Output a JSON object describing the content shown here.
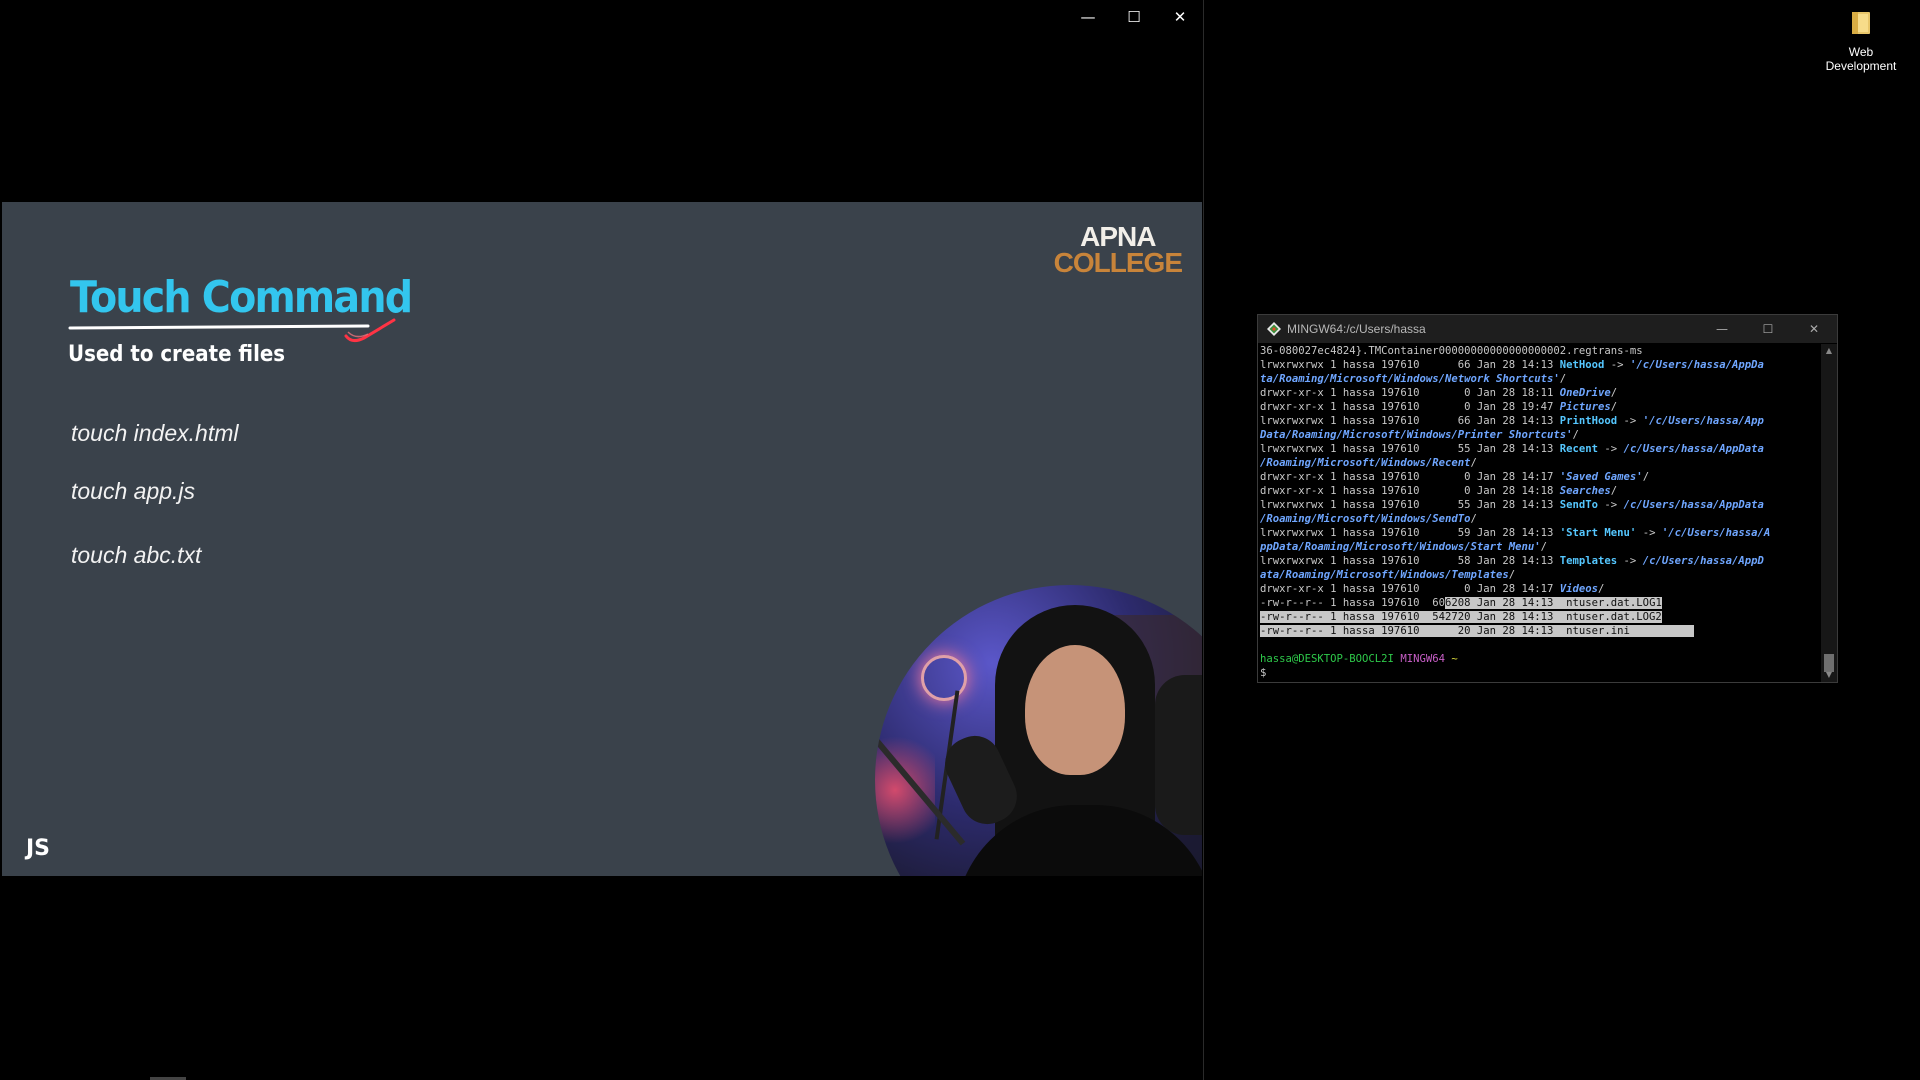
{
  "player": {
    "window_controls": {
      "minimize": "—",
      "maximize": "☐",
      "close": "✕"
    },
    "slide": {
      "brand_line1": "APNA",
      "brand_line2": "COLLEGE",
      "title": "Touch Command",
      "subtitle": "Used to create files",
      "commands": [
        "touch index.html",
        "touch app.js",
        "touch abc.txt"
      ],
      "badge": "JS"
    }
  },
  "terminal": {
    "title": "MINGW64:/c/Users/hassa",
    "controls": {
      "minimize": "—",
      "maximize": "☐",
      "close": "✕"
    },
    "lines": [
      {
        "segments": [
          {
            "t": "36-080027ec4824}.TMContainer00000000000000000002.regtrans-ms",
            "c": ""
          }
        ]
      },
      {
        "segments": [
          {
            "t": "lrwxrwxrwx 1 hassa 197610      66 Jan 28 14:13 ",
            "c": ""
          },
          {
            "t": "NetHood",
            "c": "lnk"
          },
          {
            "t": " -> ",
            "c": ""
          },
          {
            "t": "'/c/Users/hassa/AppDa",
            "c": "path"
          }
        ]
      },
      {
        "segments": [
          {
            "t": "ta/Roaming/Microsoft/Windows/Network Shortcuts'",
            "c": "path"
          },
          {
            "t": "/",
            "c": ""
          }
        ]
      },
      {
        "segments": [
          {
            "t": "drwxr-xr-x 1 hassa 197610       0 Jan 28 18:11 ",
            "c": ""
          },
          {
            "t": "OneDrive",
            "c": "dir"
          },
          {
            "t": "/",
            "c": ""
          }
        ]
      },
      {
        "segments": [
          {
            "t": "drwxr-xr-x 1 hassa 197610       0 Jan 28 19:47 ",
            "c": ""
          },
          {
            "t": "Pictures",
            "c": "dir"
          },
          {
            "t": "/",
            "c": ""
          }
        ]
      },
      {
        "segments": [
          {
            "t": "lrwxrwxrwx 1 hassa 197610      66 Jan 28 14:13 ",
            "c": ""
          },
          {
            "t": "PrintHood",
            "c": "lnk"
          },
          {
            "t": " -> ",
            "c": ""
          },
          {
            "t": "'/c/Users/hassa/App",
            "c": "path"
          }
        ]
      },
      {
        "segments": [
          {
            "t": "Data/Roaming/Microsoft/Windows/Printer Shortcuts'",
            "c": "path"
          },
          {
            "t": "/",
            "c": ""
          }
        ]
      },
      {
        "segments": [
          {
            "t": "lrwxrwxrwx 1 hassa 197610      55 Jan 28 14:13 ",
            "c": ""
          },
          {
            "t": "Recent",
            "c": "lnk"
          },
          {
            "t": " -> ",
            "c": ""
          },
          {
            "t": "/c/Users/hassa/AppData",
            "c": "path"
          }
        ]
      },
      {
        "segments": [
          {
            "t": "/Roaming/Microsoft/Windows/Recent",
            "c": "path"
          },
          {
            "t": "/",
            "c": ""
          }
        ]
      },
      {
        "segments": [
          {
            "t": "drwxr-xr-x 1 hassa 197610       0 Jan 28 14:17 ",
            "c": ""
          },
          {
            "t": "'Saved Games'",
            "c": "dir"
          },
          {
            "t": "/",
            "c": ""
          }
        ]
      },
      {
        "segments": [
          {
            "t": "drwxr-xr-x 1 hassa 197610       0 Jan 28 14:18 ",
            "c": ""
          },
          {
            "t": "Searches",
            "c": "dir"
          },
          {
            "t": "/",
            "c": ""
          }
        ]
      },
      {
        "segments": [
          {
            "t": "lrwxrwxrwx 1 hassa 197610      55 Jan 28 14:13 ",
            "c": ""
          },
          {
            "t": "SendTo",
            "c": "lnk"
          },
          {
            "t": " -> ",
            "c": ""
          },
          {
            "t": "/c/Users/hassa/AppData",
            "c": "path"
          }
        ]
      },
      {
        "segments": [
          {
            "t": "/Roaming/Microsoft/Windows/SendTo",
            "c": "path"
          },
          {
            "t": "/",
            "c": ""
          }
        ]
      },
      {
        "segments": [
          {
            "t": "lrwxrwxrwx 1 hassa 197610      59 Jan 28 14:13 ",
            "c": ""
          },
          {
            "t": "'Start Menu'",
            "c": "lnk"
          },
          {
            "t": " -> ",
            "c": ""
          },
          {
            "t": "'/c/Users/hassa/A",
            "c": "path"
          }
        ]
      },
      {
        "segments": [
          {
            "t": "ppData/Roaming/Microsoft/Windows/Start Menu'",
            "c": "path"
          },
          {
            "t": "/",
            "c": ""
          }
        ]
      },
      {
        "segments": [
          {
            "t": "lrwxrwxrwx 1 hassa 197610      58 Jan 28 14:13 ",
            "c": ""
          },
          {
            "t": "Templates",
            "c": "lnk"
          },
          {
            "t": " -> ",
            "c": ""
          },
          {
            "t": "/c/Users/hassa/AppD",
            "c": "path"
          }
        ]
      },
      {
        "segments": [
          {
            "t": "ata/Roaming/Microsoft/Windows/Templates",
            "c": "path"
          },
          {
            "t": "/",
            "c": ""
          }
        ]
      },
      {
        "segments": [
          {
            "t": "drwxr-xr-x 1 hassa 197610       0 Jan 28 14:17 ",
            "c": ""
          },
          {
            "t": "Videos",
            "c": "dir"
          },
          {
            "t": "/",
            "c": ""
          }
        ]
      },
      {
        "segments": [
          {
            "t": "-rw-r--r-- 1 hassa 197610  60",
            "c": ""
          },
          {
            "t": "6208 Jan 28 14:13  ntuser.dat.LOG1",
            "c": "sel"
          }
        ]
      },
      {
        "segments": [
          {
            "t": "-rw-r--r-- 1 hassa 197610  542720 Jan 28 14:13  ntuser.dat.LOG2",
            "c": "sel"
          }
        ]
      },
      {
        "segments": [
          {
            "t": "-rw-r--r-- 1 hassa 197610      20 Jan 28 14:13  ntuser.ini          ",
            "c": "sel"
          }
        ]
      },
      {
        "segments": [
          {
            "t": "",
            "c": ""
          }
        ]
      },
      {
        "segments": [
          {
            "t": "hassa@DESKTOP-BOOCL2I",
            "c": "prompt-user"
          },
          {
            "t": " ",
            "c": ""
          },
          {
            "t": "MINGW64",
            "c": "prompt-sys"
          },
          {
            "t": " ",
            "c": ""
          },
          {
            "t": "~",
            "c": "prompt-dir"
          }
        ]
      },
      {
        "segments": [
          {
            "t": "$ ",
            "c": ""
          }
        ]
      }
    ]
  },
  "desktop": {
    "icon_label_line1": "Web",
    "icon_label_line2": "Development",
    "icon": "folder-icon"
  }
}
